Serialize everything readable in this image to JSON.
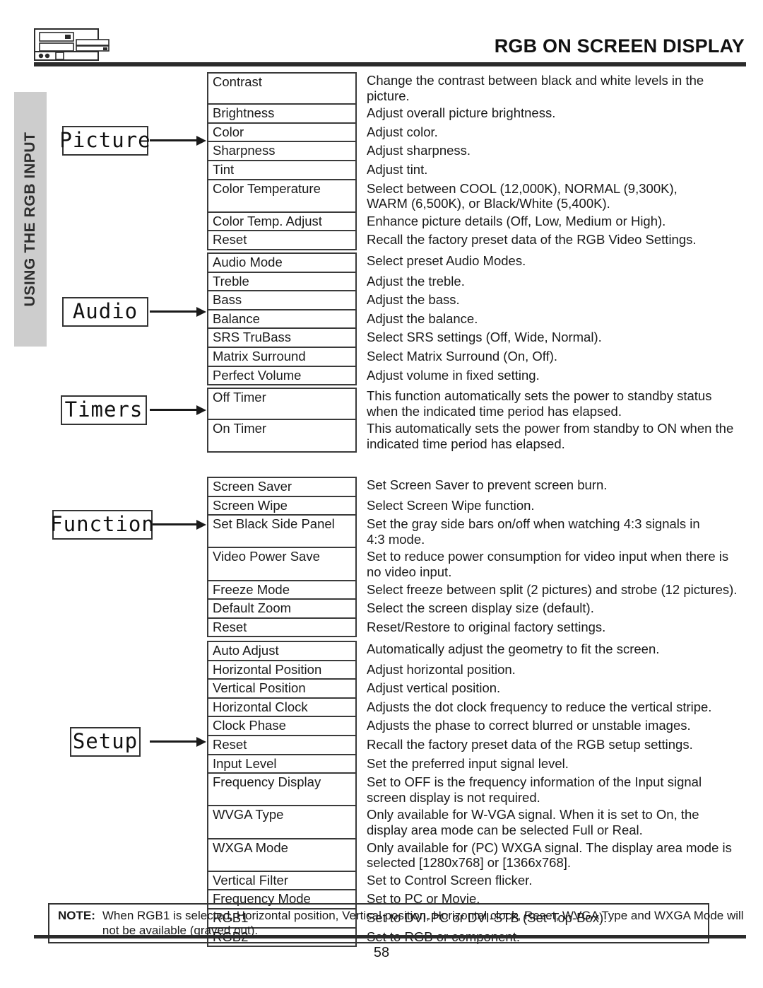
{
  "header": {
    "title": "RGB ON SCREEN DISPLAY",
    "device_icon": "av-receiver-icon"
  },
  "side_tab": {
    "label": "USING THE RGB INPUT"
  },
  "menus": [
    {
      "label": "Picture",
      "name": "menu-box-picture"
    },
    {
      "label": "Audio",
      "name": "menu-box-audio"
    },
    {
      "label": "Timers",
      "name": "menu-box-timers"
    },
    {
      "label": "Function",
      "name": "menu-box-function"
    },
    {
      "label": "Setup",
      "name": "menu-box-setup"
    }
  ],
  "sections": {
    "picture": {
      "rows": [
        {
          "name": "Contrast",
          "desc": [
            "Change the contrast between black and white levels in the",
            "picture."
          ]
        },
        {
          "name": "Brightness",
          "desc": [
            "Adjust overall picture brightness."
          ]
        },
        {
          "name": "Color",
          "desc": [
            "Adjust color."
          ]
        },
        {
          "name": "Sharpness",
          "desc": [
            "Adjust sharpness."
          ]
        },
        {
          "name": "Tint",
          "desc": [
            "Adjust tint."
          ]
        },
        {
          "name": "Color Temperature",
          "desc": [
            "Select between COOL (12,000K), NORMAL (9,300K),",
            "WARM (6,500K), or Black/White (5,400K)."
          ]
        },
        {
          "name": "Color Temp. Adjust",
          "desc": [
            "Enhance picture details (Off, Low, Medium or High)."
          ]
        },
        {
          "name": "Reset",
          "desc": [
            "Recall the factory preset data of the RGB Video Settings."
          ]
        }
      ]
    },
    "audio": {
      "rows": [
        {
          "name": "Audio Mode",
          "desc": [
            "Select preset Audio Modes."
          ]
        },
        {
          "name": "Treble",
          "desc": [
            "Adjust the treble."
          ]
        },
        {
          "name": "Bass",
          "desc": [
            "Adjust the bass."
          ]
        },
        {
          "name": "Balance",
          "desc": [
            "Adjust the balance."
          ]
        },
        {
          "name": "SRS TruBass",
          "desc": [
            "Select SRS settings (Off, Wide, Normal)."
          ]
        },
        {
          "name": "Matrix Surround",
          "desc": [
            "Select Matrix Surround (On, Off)."
          ]
        },
        {
          "name": "Perfect Volume",
          "desc": [
            "Adjust volume in fixed setting."
          ]
        }
      ]
    },
    "timers": {
      "rows": [
        {
          "name": "Off Timer",
          "desc": [
            "This function automatically sets the power to standby status",
            "when the indicated time period has elapsed."
          ]
        },
        {
          "name": "On Timer",
          "desc": [
            "This automatically sets the power from standby to ON when the",
            "indicated time period has elapsed."
          ]
        }
      ]
    },
    "function": {
      "rows": [
        {
          "name": "Screen Saver",
          "desc": [
            "Set Screen Saver to prevent screen burn."
          ]
        },
        {
          "name": "Screen Wipe",
          "desc": [
            "Select Screen Wipe function."
          ]
        },
        {
          "name": "Set Black Side Panel",
          "desc": [
            "Set the gray side bars on/off when watching 4:3 signals in",
            "4:3 mode."
          ]
        },
        {
          "name": "Video Power Save",
          "desc": [
            "Set to reduce power consumption for video input when there is",
            "no video input."
          ]
        },
        {
          "name": "Freeze Mode",
          "desc": [
            "Select freeze between split (2 pictures) and strobe (12 pictures)."
          ]
        },
        {
          "name": "Default Zoom",
          "desc": [
            "Select the screen display size (default)."
          ]
        },
        {
          "name": "Reset",
          "desc": [
            "Reset/Restore to original factory settings."
          ]
        }
      ]
    },
    "setup": {
      "rows": [
        {
          "name": "Auto Adjust",
          "desc": [
            "Automatically adjust the geometry to fit the screen."
          ]
        },
        {
          "name": "Horizontal Position",
          "desc": [
            "Adjust horizontal position."
          ]
        },
        {
          "name": "Vertical Position",
          "desc": [
            "Adjust vertical position."
          ]
        },
        {
          "name": "Horizontal Clock",
          "desc": [
            "Adjusts the dot clock frequency to reduce the vertical stripe."
          ]
        },
        {
          "name": "Clock Phase",
          "desc": [
            "Adjusts the phase to correct blurred or unstable images."
          ]
        },
        {
          "name": "Reset",
          "desc": [
            "Recall the factory preset data of the RGB setup settings."
          ]
        },
        {
          "name": "Input Level",
          "desc": [
            "Set the preferred input signal level."
          ]
        },
        {
          "name": "Frequency Display",
          "desc": [
            "Set to OFF is the frequency information of the Input signal",
            "screen display is not required."
          ]
        },
        {
          "name": "WVGA Type",
          "desc": [
            "Only available for W-VGA signal. When it is set to On, the",
            "display area mode can be selected Full or Real."
          ]
        },
        {
          "name": "WXGA Mode",
          "desc": [
            "Only available for (PC) WXGA signal. The display area mode is",
            "selected [1280x768] or [1366x768]."
          ]
        },
        {
          "name": "Vertical Filter",
          "desc": [
            "Set to Control Screen flicker."
          ]
        },
        {
          "name": "Frequency Mode",
          "desc": [
            "Set to PC or Movie."
          ]
        },
        {
          "name": "RGB1",
          "desc": [
            "Set to DVI-PC or DVI-STB (Set-Top-Box)."
          ]
        },
        {
          "name": "RGB2",
          "desc": [
            "Set to RGB or component."
          ]
        }
      ]
    }
  },
  "note": {
    "label": "NOTE:",
    "lines": [
      "When RGB1 is selected, Horizontal position, Vertical position, Horizontal clock, Reset, WVGA Type and WXGA Mode will",
      "not be available (grayed out)."
    ]
  },
  "footer": {
    "page_number": "58"
  }
}
